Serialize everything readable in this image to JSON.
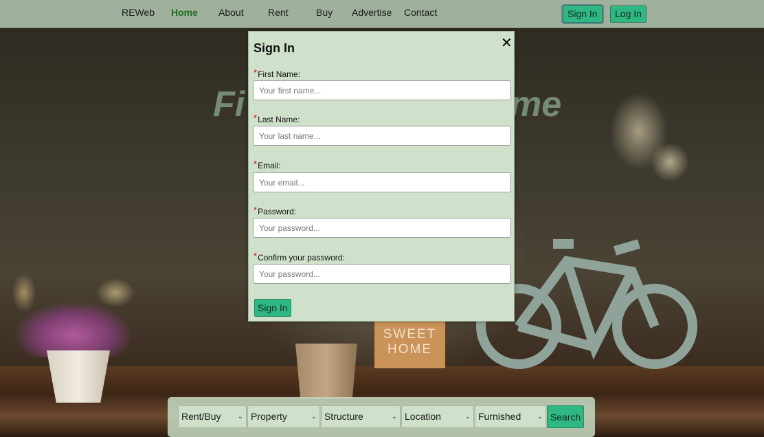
{
  "nav": {
    "brand": "REWeb",
    "items": [
      {
        "label": "Home",
        "active": true
      },
      {
        "label": "About",
        "active": false
      },
      {
        "label": "Rent",
        "active": false
      },
      {
        "label": "Buy",
        "active": false
      },
      {
        "label": "Advertise",
        "active": false
      },
      {
        "label": "Contact",
        "active": false
      }
    ],
    "signin_label": "Sign In",
    "login_label": "Log In"
  },
  "hero": {
    "title_left": "Fi",
    "title_right": "me"
  },
  "background": {
    "sign_text": "SWEET HOME"
  },
  "modal": {
    "title": "Sign In",
    "close_icon": "close-icon",
    "fields": [
      {
        "label": "First Name:",
        "placeholder": "Your first name...",
        "required": true
      },
      {
        "label": "Last Name:",
        "placeholder": "Your last name...",
        "required": true
      },
      {
        "label": "Email:",
        "placeholder": "Your email...",
        "required": true
      },
      {
        "label": "Password:",
        "placeholder": "Your password...",
        "required": true
      },
      {
        "label": "Confirm your password:",
        "placeholder": "Your password...",
        "required": true
      }
    ],
    "required_marker": "*",
    "submit_label": "Sign In"
  },
  "search": {
    "selects": [
      {
        "value": "Rent/Buy"
      },
      {
        "value": "Property"
      },
      {
        "value": "Structure"
      },
      {
        "value": "Location"
      },
      {
        "value": "Furnished"
      }
    ],
    "button_label": "Search"
  },
  "colors": {
    "accent": "#2fb884",
    "nav_bg": "#9fb09c",
    "modal_bg": "#cfe1cb",
    "active_nav": "#1f6a1f",
    "required": "#d00000"
  }
}
